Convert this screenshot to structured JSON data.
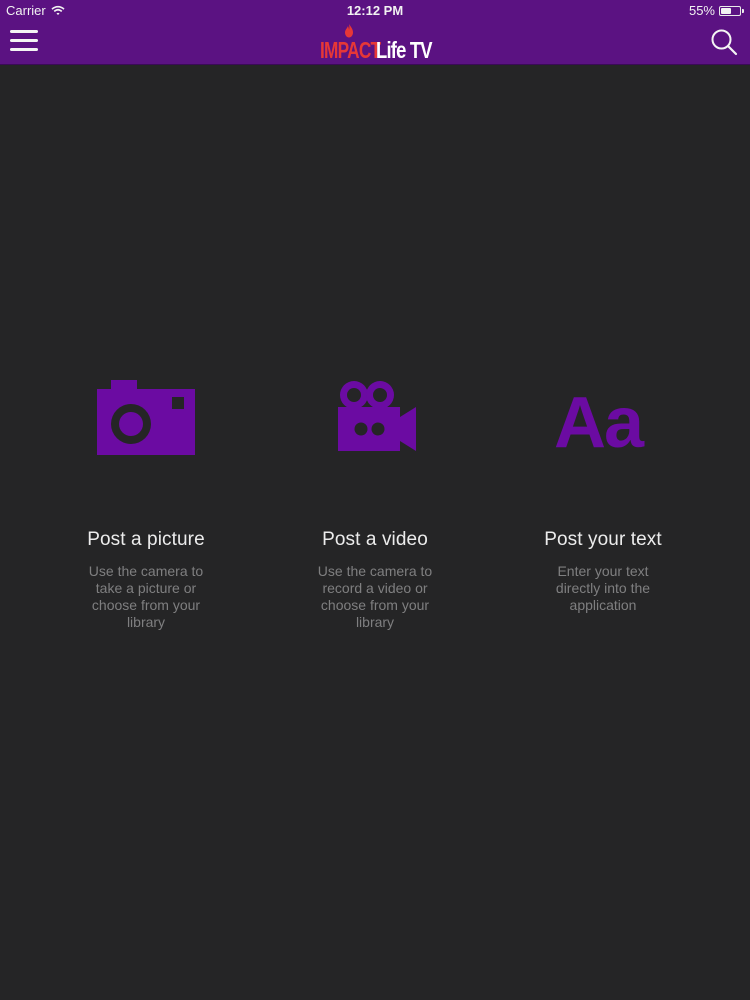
{
  "status_bar": {
    "carrier": "Carrier",
    "time": "12:12 PM",
    "battery": "55%",
    "battery_level": 0.55
  },
  "header": {
    "logo_part1": "IMPACT",
    "logo_part2": "Life TV",
    "menu_icon": "hamburger-menu-icon",
    "search_icon": "search-icon",
    "brand_color": "#5b1282",
    "logo_accent_color": "#e63737"
  },
  "post_options": [
    {
      "icon": "camera-icon",
      "title": "Post a picture",
      "description": "Use the camera to take a picture or choose from your library"
    },
    {
      "icon": "video-camera-icon",
      "title": "Post a video",
      "description": "Use the camera to record a video or choose from your library"
    },
    {
      "icon": "text-icon",
      "icon_text": "Aa",
      "title": "Post your text",
      "description": "Enter your text directly into the application"
    }
  ],
  "colors": {
    "background": "#252526",
    "icon_purple": "#6b0ba2",
    "title_text": "#ececec",
    "description_text": "#7f7f80"
  }
}
